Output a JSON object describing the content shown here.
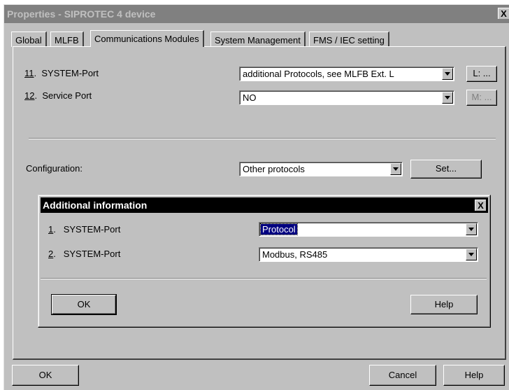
{
  "window": {
    "title": "Properties - SIPROTEC 4 device",
    "close_glyph": "X"
  },
  "tabs": [
    {
      "label": "Global"
    },
    {
      "label": "MLFB"
    },
    {
      "label": "Communications Modules"
    },
    {
      "label": "System Management"
    },
    {
      "label": "FMS / IEC setting"
    }
  ],
  "active_tab": "Communications Modules",
  "comm": {
    "row11": {
      "num": "11",
      "dot": ".",
      "label": "SYSTEM-Port",
      "value": "additional Protocols, see MLFB Ext. L",
      "btn": "L: ..."
    },
    "row12": {
      "num": "12",
      "dot": ".",
      "label": "Service Port",
      "value": "NO",
      "btn": "M: ..."
    },
    "config": {
      "label": "Configuration:",
      "value": "Other protocols",
      "btn": "Set..."
    }
  },
  "sub_dialog": {
    "title": "Additional information",
    "close_glyph": "X",
    "row1": {
      "num": "1",
      "dot": ".",
      "label": "SYSTEM-Port",
      "value": "Protocol"
    },
    "row2": {
      "num": "2",
      "dot": ".",
      "label": "SYSTEM-Port",
      "value": "Modbus, RS485"
    },
    "ok": "OK",
    "help": "Help"
  },
  "footer": {
    "ok": "OK",
    "cancel": "Cancel",
    "help": "Help"
  }
}
